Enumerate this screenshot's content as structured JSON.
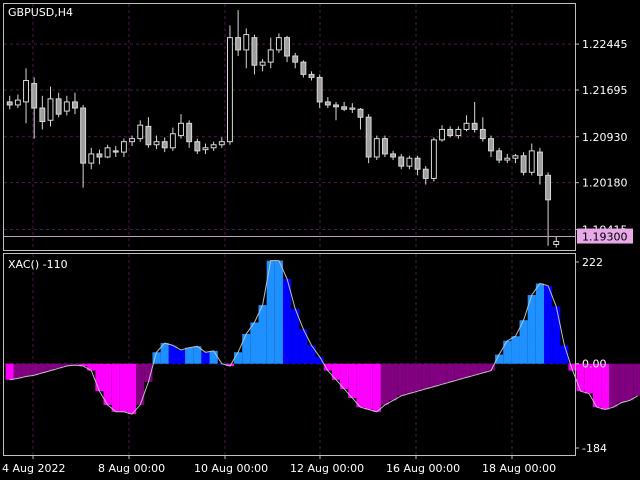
{
  "symbol_label": "GBPUSD,H4",
  "indicator_label": "XAC() -110",
  "price_axis": {
    "ticks": [
      "1.22445",
      "1.21695",
      "1.20930",
      "1.20180",
      "1.19415"
    ],
    "current_price": "1.19300"
  },
  "indicator_axis": {
    "ticks": [
      "222",
      "0.00",
      "-184"
    ]
  },
  "time_axis": {
    "labels": [
      "4 Aug 2022",
      "8 Aug 00:00",
      "10 Aug 00:00",
      "12 Aug 00:00",
      "16 Aug 00:00",
      "18 Aug 00:00"
    ]
  },
  "colors": {
    "background": "#000000",
    "grid": "#4a1b4a",
    "frame": "#c0c0c0",
    "candle_fill": "#9e9e9e",
    "candle_wick": "#d8d8d8",
    "hist_positive": "#1e90ff",
    "hist_positive_dark": "#0000ff",
    "hist_negative": "#ff00ff",
    "hist_negative_dark": "#800080",
    "price_tag_bg": "#e7a9e8",
    "price_line": "#c0a0c0"
  },
  "chart_data": [
    {
      "type": "candlestick",
      "title": "GBPUSD,H4",
      "ylim": [
        1.1908,
        1.231
      ],
      "candles": [
        [
          1.215,
          1.2145,
          1.216,
          1.2138
        ],
        [
          1.2145,
          1.2153,
          1.2162,
          1.214
        ],
        [
          1.215,
          1.2185,
          1.2205,
          1.2115
        ],
        [
          1.218,
          1.214,
          1.219,
          1.209
        ],
        [
          1.214,
          1.2118,
          1.216,
          1.2105
        ],
        [
          1.212,
          1.2155,
          1.2175,
          1.211
        ],
        [
          1.2155,
          1.213,
          1.2165,
          1.2125
        ],
        [
          1.2135,
          1.215,
          1.216,
          1.2128
        ],
        [
          1.215,
          1.214,
          1.2165,
          1.213
        ],
        [
          1.214,
          1.205,
          1.2145,
          1.201
        ],
        [
          1.205,
          1.2065,
          1.2075,
          1.204
        ],
        [
          1.2065,
          1.206,
          1.2072,
          1.2048
        ],
        [
          1.206,
          1.2075,
          1.208,
          1.2058
        ],
        [
          1.207,
          1.2068,
          1.2078,
          1.206
        ],
        [
          1.2068,
          1.2085,
          1.209,
          1.206
        ],
        [
          1.2085,
          1.209,
          1.2095,
          1.2078
        ],
        [
          1.209,
          1.2112,
          1.212,
          1.2085
        ],
        [
          1.211,
          1.208,
          1.2125,
          1.2075
        ],
        [
          1.208,
          1.2085,
          1.2095,
          1.2073
        ],
        [
          1.2085,
          1.2075,
          1.2092,
          1.2068
        ],
        [
          1.2075,
          1.2098,
          1.2108,
          1.207
        ],
        [
          1.2095,
          1.2115,
          1.213,
          1.209
        ],
        [
          1.2115,
          1.2085,
          1.212,
          1.2075
        ],
        [
          1.2085,
          1.207,
          1.209,
          1.2065
        ],
        [
          1.2072,
          1.2075,
          1.2082,
          1.2065
        ],
        [
          1.2075,
          1.208,
          1.2085,
          1.207
        ],
        [
          1.208,
          1.2085,
          1.2092,
          1.2075
        ],
        [
          1.2085,
          1.2255,
          1.2275,
          1.208
        ],
        [
          1.2255,
          1.2235,
          1.23,
          1.2225
        ],
        [
          1.2235,
          1.226,
          1.227,
          1.2205
        ],
        [
          1.2255,
          1.221,
          1.226,
          1.2195
        ],
        [
          1.221,
          1.2215,
          1.222,
          1.22
        ],
        [
          1.2215,
          1.2235,
          1.2255,
          1.2205
        ],
        [
          1.2235,
          1.2255,
          1.2262,
          1.223
        ],
        [
          1.2255,
          1.2225,
          1.2258,
          1.2215
        ],
        [
          1.2225,
          1.2215,
          1.223,
          1.2205
        ],
        [
          1.2215,
          1.2195,
          1.2218,
          1.219
        ],
        [
          1.2195,
          1.219,
          1.22,
          1.2185
        ],
        [
          1.219,
          1.215,
          1.2195,
          1.214
        ],
        [
          1.215,
          1.2145,
          1.2158,
          1.214
        ],
        [
          1.2145,
          1.2142,
          1.215,
          1.212
        ],
        [
          1.2142,
          1.2138,
          1.215,
          1.2135
        ],
        [
          1.2138,
          1.214,
          1.2148,
          1.2132
        ],
        [
          1.2138,
          1.2125,
          1.214,
          1.2105
        ],
        [
          1.2125,
          1.206,
          1.213,
          1.205
        ],
        [
          1.206,
          1.209,
          1.2095,
          1.2055
        ],
        [
          1.209,
          1.2065,
          1.2095,
          1.206
        ],
        [
          1.2065,
          1.206,
          1.207,
          1.2055
        ],
        [
          1.206,
          1.2045,
          1.2065,
          1.204
        ],
        [
          1.2045,
          1.2058,
          1.2062,
          1.204
        ],
        [
          1.2058,
          1.204,
          1.2062,
          1.203
        ],
        [
          1.204,
          1.2025,
          1.2045,
          1.2015
        ],
        [
          1.2025,
          1.2088,
          1.2092,
          1.202
        ],
        [
          1.2088,
          1.2105,
          1.2112,
          1.2085
        ],
        [
          1.2105,
          1.2095,
          1.211,
          1.2092
        ],
        [
          1.2095,
          1.2105,
          1.211,
          1.209
        ],
        [
          1.2105,
          1.2115,
          1.2128,
          1.2102
        ],
        [
          1.2115,
          1.2105,
          1.215,
          1.21
        ],
        [
          1.2105,
          1.209,
          1.2125,
          1.2085
        ],
        [
          1.209,
          1.207,
          1.2095,
          1.206
        ],
        [
          1.207,
          1.2055,
          1.2075,
          1.205
        ],
        [
          1.2055,
          1.2058,
          1.2065,
          1.205
        ],
        [
          1.2058,
          1.2062,
          1.2065,
          1.205
        ],
        [
          1.2062,
          1.2035,
          1.2068,
          1.203
        ],
        [
          1.2035,
          1.207,
          1.2082,
          1.203
        ],
        [
          1.2068,
          1.203,
          1.2075,
          1.2015
        ],
        [
          1.203,
          1.199,
          1.2035,
          1.1915
        ],
        [
          1.1917,
          1.1922,
          1.193,
          1.1912
        ]
      ]
    },
    {
      "type": "bar",
      "title": "XAC() -110",
      "ylim": [
        -184,
        222
      ],
      "values": [
        -35,
        -32,
        -28,
        -25,
        -20,
        -15,
        -10,
        -5,
        -3,
        -5,
        -15,
        -60,
        -90,
        -105,
        -105,
        -110,
        -90,
        -40,
        25,
        45,
        40,
        30,
        35,
        38,
        25,
        28,
        0,
        -5,
        25,
        65,
        90,
        128,
        225,
        225,
        185,
        120,
        75,
        40,
        15,
        -15,
        -35,
        -55,
        -75,
        -95,
        -100,
        -105,
        -90,
        -80,
        -70,
        -65,
        -60,
        -55,
        -50,
        -45,
        -40,
        -35,
        -30,
        -25,
        -20,
        -15,
        20,
        50,
        60,
        95,
        150,
        175,
        170,
        125,
        40,
        -15,
        -60,
        -65,
        -95,
        -100,
        -95,
        -85,
        -80,
        -70
      ]
    }
  ]
}
